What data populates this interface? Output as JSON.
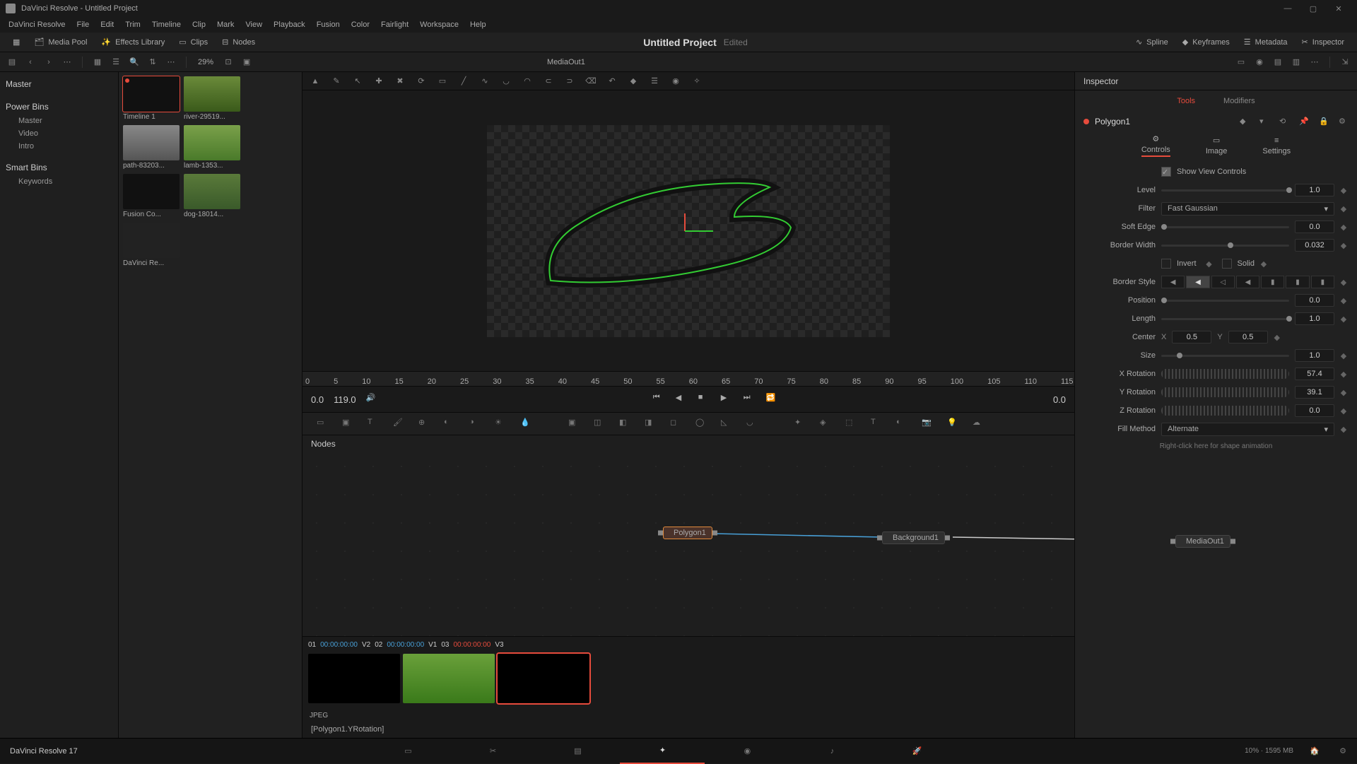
{
  "window": {
    "title": "DaVinci Resolve - Untitled Project"
  },
  "menu": [
    "DaVinci Resolve",
    "File",
    "Edit",
    "Trim",
    "Timeline",
    "Clip",
    "Mark",
    "View",
    "Playback",
    "Fusion",
    "Color",
    "Fairlight",
    "Workspace",
    "Help"
  ],
  "toolbar": {
    "mediaPool": "Media Pool",
    "effects": "Effects Library",
    "clips": "Clips",
    "nodes": "Nodes",
    "title": "Untitled Project",
    "status": "Edited",
    "spline": "Spline",
    "keyframes": "Keyframes",
    "metadata": "Metadata",
    "inspector": "Inspector"
  },
  "subbar": {
    "zoom": "29%",
    "viewerTitle": "MediaOut1"
  },
  "bins": {
    "master": "Master",
    "power": "Power Bins",
    "powerItems": [
      "Master",
      "Video",
      "Intro"
    ],
    "smart": "Smart Bins",
    "smartItems": [
      "Keywords"
    ]
  },
  "clips": [
    "Timeline 1",
    "river-29519...",
    "path-83203...",
    "lamb-1353...",
    "Fusion Co...",
    "dog-18014...",
    "DaVinci Re..."
  ],
  "ruler": [
    "0",
    "5",
    "10",
    "15",
    "20",
    "25",
    "30",
    "35",
    "40",
    "45",
    "50",
    "55",
    "60",
    "65",
    "70",
    "75",
    "80",
    "85",
    "90",
    "95",
    "100",
    "105",
    "110",
    "115"
  ],
  "transport": {
    "cur": "0.0",
    "end": "119.0",
    "right": "0.0"
  },
  "nodesPanel": {
    "title": "Nodes",
    "n1": "Polygon1",
    "n2": "Background1",
    "n3": "MediaOut1"
  },
  "timeline": {
    "items": [
      {
        "num": "01",
        "tc": "00:00:00:00",
        "trk": "V2"
      },
      {
        "num": "02",
        "tc": "00:00:00:00",
        "trk": "V1"
      },
      {
        "num": "03",
        "tc": "00:00:00:00",
        "trk": "V3"
      }
    ],
    "format": "JPEG"
  },
  "status": {
    "left": "[Polygon1.YRotation]",
    "app": "DaVinci Resolve 17",
    "right": "10% · 1595 MB"
  },
  "inspector": {
    "hdr": "Inspector",
    "tabs": {
      "tools": "Tools",
      "modifiers": "Modifiers"
    },
    "node": "Polygon1",
    "subtabs": {
      "controls": "Controls",
      "image": "Image",
      "settings": "Settings"
    },
    "showView": "Show View Controls",
    "level": {
      "lbl": "Level",
      "val": "1.0"
    },
    "filter": {
      "lbl": "Filter",
      "val": "Fast Gaussian"
    },
    "softEdge": {
      "lbl": "Soft Edge",
      "val": "0.0"
    },
    "borderWidth": {
      "lbl": "Border Width",
      "val": "0.032"
    },
    "invert": "Invert",
    "solid": "Solid",
    "borderStyle": "Border Style",
    "position": {
      "lbl": "Position",
      "val": "0.0"
    },
    "length": {
      "lbl": "Length",
      "val": "1.0"
    },
    "center": {
      "lbl": "Center",
      "x": "X",
      "xval": "0.5",
      "y": "Y",
      "yval": "0.5"
    },
    "size": {
      "lbl": "Size",
      "val": "1.0"
    },
    "xrot": {
      "lbl": "X Rotation",
      "val": "57.4"
    },
    "yrot": {
      "lbl": "Y Rotation",
      "val": "39.1"
    },
    "zrot": {
      "lbl": "Z Rotation",
      "val": "0.0"
    },
    "fill": {
      "lbl": "Fill Method",
      "val": "Alternate"
    },
    "hint": "Right-click here for shape animation"
  }
}
